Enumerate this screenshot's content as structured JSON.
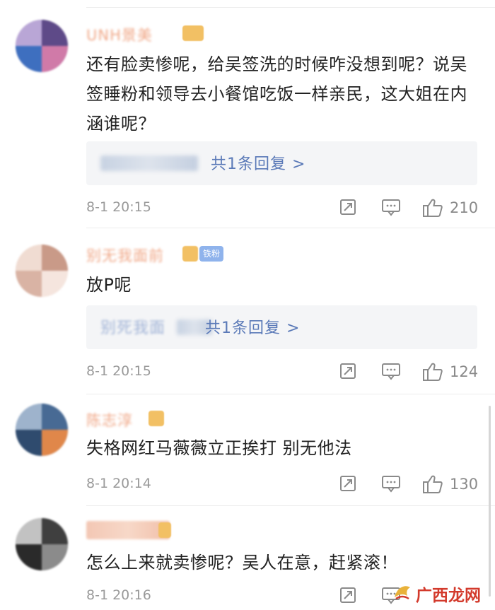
{
  "comments": [
    {
      "username": "UNH景美",
      "text": "还有脸卖惨呢，给吴签洗的时候咋没想到呢？说吴签睡粉和领导去小餐馆吃饭一样亲民，这大姐在内涵谁呢？",
      "reply_text": "共1条回复 >",
      "time": "8-1 20:15",
      "likes": "210"
    },
    {
      "username": "别无我面前",
      "badge": "铁粉",
      "text": "放P呢",
      "reply_text": "共1条回复 >",
      "reply_prefix": "别死我面",
      "time": "8-1 20:15",
      "likes": "124"
    },
    {
      "username": "陈志淳",
      "text": "失格网红马薇薇立正挨打 别无他法",
      "time": "8-1 20:14",
      "likes": "130"
    },
    {
      "username": "",
      "text": "怎么上来就卖惨呢？吴人在意，赶紧滚！",
      "time": "8-1 20:16",
      "likes": ""
    }
  ],
  "watermark": {
    "text": "广西龙网",
    "icon": "watermark-logo-icon"
  },
  "icons": {
    "repost": "repost-icon",
    "comment": "comment-icon",
    "like": "thumbs-up-icon"
  },
  "colors": {
    "link": "#5b7ab8",
    "watermark": "#d33a2c",
    "meta": "#9a9a9a"
  }
}
